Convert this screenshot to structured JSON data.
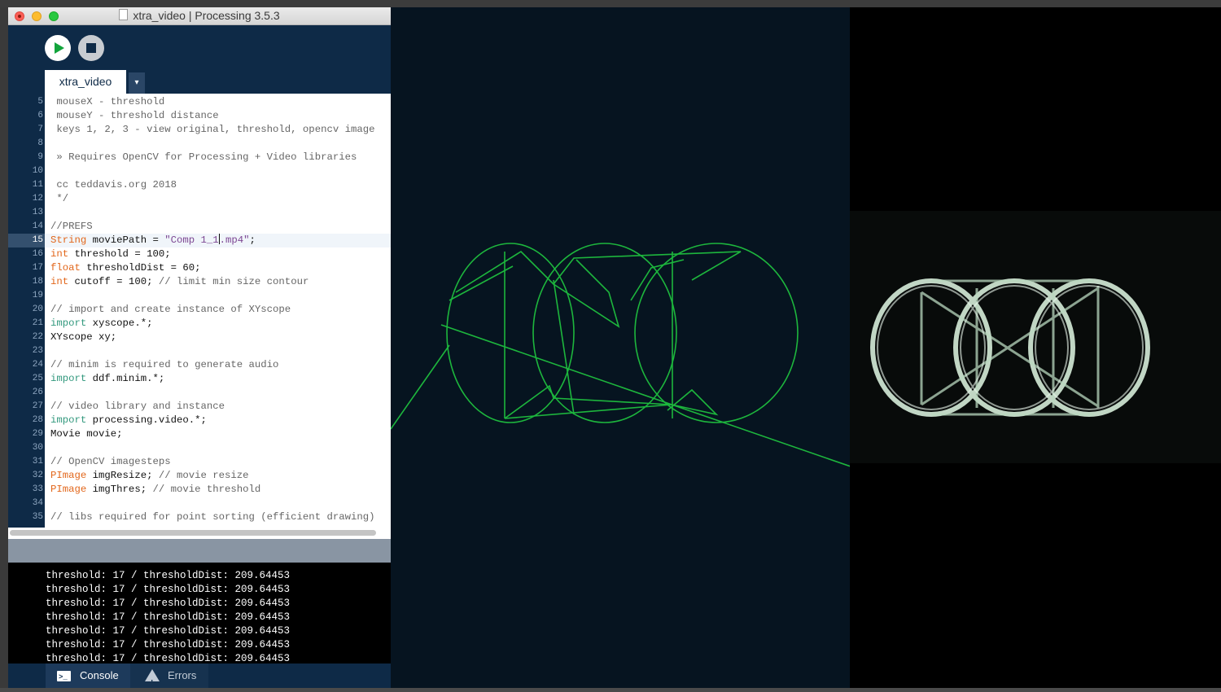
{
  "window": {
    "title": "xtra_video | Processing 3.5.3"
  },
  "toolbar": {
    "run_icon": "play-icon",
    "stop_icon": "stop-icon"
  },
  "tabs": {
    "active": "xtra_video",
    "menu_glyph": "▾"
  },
  "editor": {
    "lines": [
      {
        "n": "5",
        "t": " mouseX - threshold"
      },
      {
        "n": "6",
        "t": " mouseY - threshold distance"
      },
      {
        "n": "7",
        "t": " keys 1, 2, 3 - view original, threshold, opencv image"
      },
      {
        "n": "8",
        "t": ""
      },
      {
        "n": "9",
        "t": " » Requires OpenCV for Processing + Video libraries"
      },
      {
        "n": "10",
        "t": ""
      },
      {
        "n": "11",
        "t": " cc teddavis.org 2018"
      },
      {
        "n": "12",
        "t": " */"
      },
      {
        "n": "13",
        "t": ""
      },
      {
        "n": "14",
        "t": "//PREFS"
      },
      {
        "n": "15",
        "kw": "String",
        "rest": " moviePath = ",
        "str1": "\"Comp 1_1",
        "str2": ".mp4\"",
        "end": ";"
      },
      {
        "n": "16",
        "kw": "int",
        "rest": " threshold = 100;"
      },
      {
        "n": "17",
        "kw": "float",
        "rest": " thresholdDist = 60;"
      },
      {
        "n": "18",
        "kw": "int",
        "rest": " cutoff = 100; ",
        "cm": "// limit min size contour"
      },
      {
        "n": "19",
        "t": ""
      },
      {
        "n": "20",
        "t": "// import and create instance of XYscope"
      },
      {
        "n": "21",
        "kw2": "import",
        "rest": " xyscope.*;"
      },
      {
        "n": "22",
        "t": "XYscope xy;"
      },
      {
        "n": "23",
        "t": ""
      },
      {
        "n": "24",
        "t": "// minim is required to generate audio"
      },
      {
        "n": "25",
        "kw2": "import",
        "rest": " ddf.minim.*;"
      },
      {
        "n": "26",
        "t": ""
      },
      {
        "n": "27",
        "t": "// video library and instance"
      },
      {
        "n": "28",
        "kw2": "import",
        "rest": " processing.video.*;"
      },
      {
        "n": "29",
        "t": "Movie movie;"
      },
      {
        "n": "30",
        "t": ""
      },
      {
        "n": "31",
        "t": "// OpenCV imagesteps"
      },
      {
        "n": "32",
        "kw": "PImage",
        "rest": " imgResize; ",
        "cm": "// movie resize"
      },
      {
        "n": "33",
        "kw": "PImage",
        "rest": " imgThres; ",
        "cm": "// movie threshold"
      },
      {
        "n": "34",
        "t": ""
      },
      {
        "n": "35",
        "t": "// libs required for point sorting (efficient drawing)"
      }
    ]
  },
  "console": {
    "lines": [
      "threshold: 17 / thresholdDist: 209.64453",
      "threshold: 17 / thresholdDist: 209.64453",
      "threshold: 17 / thresholdDist: 209.64453",
      "threshold: 17 / thresholdDist: 209.64453",
      "threshold: 17 / thresholdDist: 209.64453",
      "threshold: 17 / thresholdDist: 209.64453",
      "threshold: 17 / thresholdDist: 209.64453"
    ]
  },
  "bottom_tabs": {
    "console": "Console",
    "errors": "Errors"
  },
  "colors": {
    "ide_blue": "#0e2a47",
    "scope_green": "#1fbf3f",
    "video_green": "#cfe8d4"
  }
}
